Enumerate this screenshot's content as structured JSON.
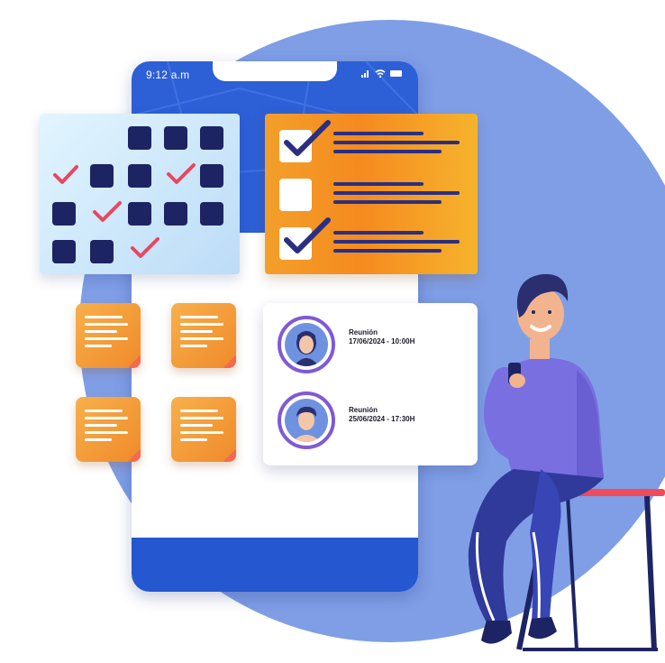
{
  "status_bar": {
    "time": "9:12 a.m",
    "signal_icon": "signal-bars-icon",
    "wifi_icon": "wifi-icon",
    "battery_icon": "battery-icon"
  },
  "meetings": [
    {
      "title": "Reunión",
      "datetime": "17/06/2024 - 10:00H",
      "avatar": "woman-avatar-icon"
    },
    {
      "title": "Reunión",
      "datetime": "25/06/2024 - 17:30H",
      "avatar": "man-avatar-icon"
    }
  ],
  "colors": {
    "background_circle": "#7f9ee6",
    "phone_blue": "#2d5fd6",
    "task_orange": "#f58a1f",
    "calendar_square": "#1d2463",
    "check_red": "#e8475f",
    "avatar_ring": "#7f5ad6"
  },
  "task_list": {
    "items": [
      {
        "checked": true
      },
      {
        "checked": false
      },
      {
        "checked": true
      }
    ]
  }
}
